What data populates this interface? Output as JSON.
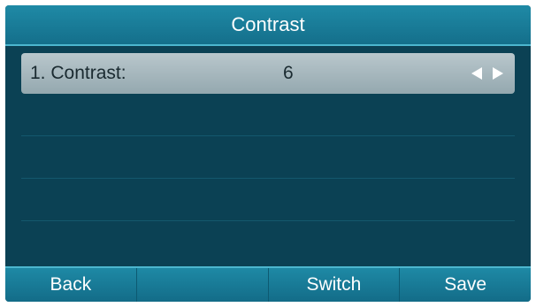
{
  "title": "Contrast",
  "items": [
    {
      "label": "1. Contrast:",
      "value": "6",
      "selected": true
    }
  ],
  "softkeys": [
    "Back",
    "",
    "Switch",
    "Save"
  ],
  "icons": {
    "left": "left-arrow-icon",
    "right": "right-arrow-icon"
  },
  "colors": {
    "background": "#0b4154",
    "title_bar": "#1f8aa6",
    "selected_row": "#b9c7cc",
    "text": "#ffffff"
  }
}
